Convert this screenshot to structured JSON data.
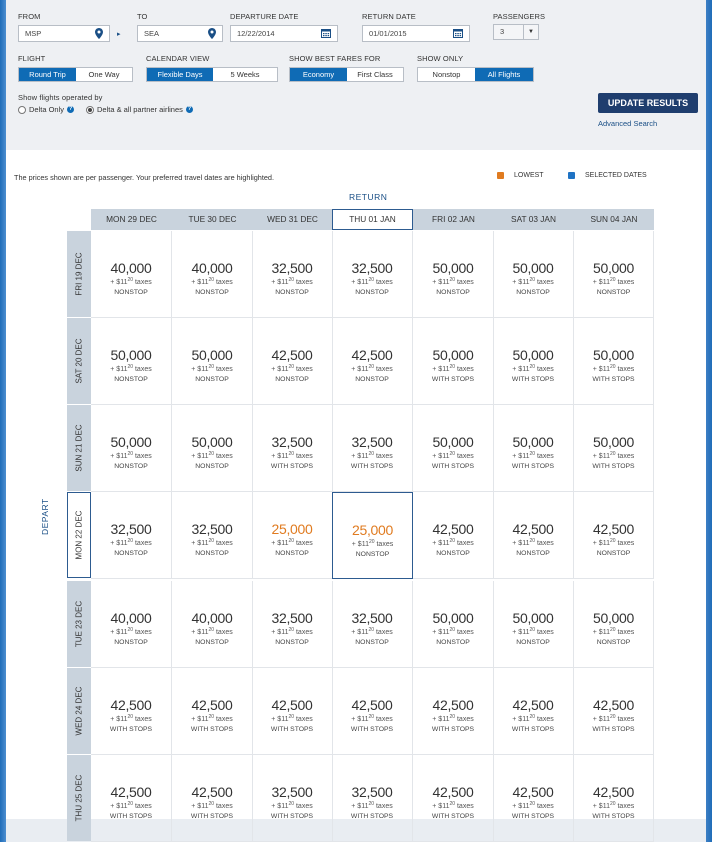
{
  "search": {
    "from_label": "FROM",
    "from_value": "MSP",
    "to_label": "TO",
    "to_value": "SEA",
    "departure_label": "DEPARTURE DATE",
    "departure_value": "12/22/2014",
    "return_label": "RETURN DATE",
    "return_value": "01/01/2015",
    "passengers_label": "PASSENGERS",
    "passengers_value": "3",
    "flight_label": "FLIGHT",
    "flight_options": [
      "Round Trip",
      "One Way"
    ],
    "flight_selected": "Round Trip",
    "calendar_label": "CALENDAR VIEW",
    "calendar_options": [
      "Flexible Days",
      "5 Weeks"
    ],
    "calendar_selected": "Flexible Days",
    "fares_label": "SHOW BEST FARES FOR",
    "fares_options": [
      "Economy",
      "First Class"
    ],
    "fares_selected": "Economy",
    "showonly_label": "SHOW ONLY",
    "showonly_options": [
      "Nonstop",
      "All Flights"
    ],
    "showonly_selected": "All Flights",
    "operated_label": "Show flights operated by",
    "operated_options": [
      "Delta Only",
      "Delta & all partner airlines"
    ],
    "operated_selected": "Delta & all partner airlines",
    "update_button": "UPDATE RESULTS",
    "advanced_link": "Advanced Search"
  },
  "calendar": {
    "note": "The prices shown are per passenger. Your preferred travel dates are highlighted.",
    "legend_lowest": "LOWEST",
    "legend_selected": "SELECTED DATES",
    "legend_lowest_color": "#e07b20",
    "legend_selected_color": "#1f73c4",
    "return_label": "RETURN",
    "depart_label": "DEPART",
    "return_dates": [
      "MON 29 DEC",
      "TUE 30 DEC",
      "WED 31 DEC",
      "THU 01 JAN",
      "FRI 02 JAN",
      "SAT 03 JAN",
      "SUN 04 JAN"
    ],
    "selected_return_index": 3,
    "depart_dates": [
      "FRI 19 DEC",
      "SAT 20 DEC",
      "SUN 21 DEC",
      "MON 22 DEC",
      "TUE 23 DEC",
      "WED 24 DEC",
      "THU 25 DEC"
    ],
    "selected_depart_index": 3,
    "tax_prefix": "+ $",
    "tax_amount": "11",
    "tax_cents": "20",
    "tax_suffix": " taxes",
    "rows": [
      [
        [
          "40,000",
          "NONSTOP"
        ],
        [
          "40,000",
          "NONSTOP"
        ],
        [
          "32,500",
          "NONSTOP"
        ],
        [
          "32,500",
          "NONSTOP"
        ],
        [
          "50,000",
          "NONSTOP"
        ],
        [
          "50,000",
          "NONSTOP"
        ],
        [
          "50,000",
          "NONSTOP"
        ]
      ],
      [
        [
          "50,000",
          "NONSTOP"
        ],
        [
          "50,000",
          "NONSTOP"
        ],
        [
          "42,500",
          "NONSTOP"
        ],
        [
          "42,500",
          "NONSTOP"
        ],
        [
          "50,000",
          "WITH STOPS"
        ],
        [
          "50,000",
          "WITH STOPS"
        ],
        [
          "50,000",
          "WITH STOPS"
        ]
      ],
      [
        [
          "50,000",
          "NONSTOP"
        ],
        [
          "50,000",
          "NONSTOP"
        ],
        [
          "32,500",
          "WITH STOPS"
        ],
        [
          "32,500",
          "WITH STOPS"
        ],
        [
          "50,000",
          "WITH STOPS"
        ],
        [
          "50,000",
          "WITH STOPS"
        ],
        [
          "50,000",
          "WITH STOPS"
        ]
      ],
      [
        [
          "32,500",
          "NONSTOP"
        ],
        [
          "32,500",
          "NONSTOP"
        ],
        [
          "25,000",
          "NONSTOP"
        ],
        [
          "25,000",
          "NONSTOP"
        ],
        [
          "42,500",
          "NONSTOP"
        ],
        [
          "42,500",
          "NONSTOP"
        ],
        [
          "42,500",
          "NONSTOP"
        ]
      ],
      [
        [
          "40,000",
          "NONSTOP"
        ],
        [
          "40,000",
          "NONSTOP"
        ],
        [
          "32,500",
          "NONSTOP"
        ],
        [
          "32,500",
          "NONSTOP"
        ],
        [
          "50,000",
          "NONSTOP"
        ],
        [
          "50,000",
          "NONSTOP"
        ],
        [
          "50,000",
          "NONSTOP"
        ]
      ],
      [
        [
          "42,500",
          "WITH STOPS"
        ],
        [
          "42,500",
          "WITH STOPS"
        ],
        [
          "42,500",
          "WITH STOPS"
        ],
        [
          "42,500",
          "WITH STOPS"
        ],
        [
          "42,500",
          "WITH STOPS"
        ],
        [
          "42,500",
          "WITH STOPS"
        ],
        [
          "42,500",
          "WITH STOPS"
        ]
      ],
      [
        [
          "42,500",
          "WITH STOPS"
        ],
        [
          "42,500",
          "WITH STOPS"
        ],
        [
          "32,500",
          "WITH STOPS"
        ],
        [
          "32,500",
          "WITH STOPS"
        ],
        [
          "42,500",
          "WITH STOPS"
        ],
        [
          "42,500",
          "WITH STOPS"
        ],
        [
          "42,500",
          "WITH STOPS"
        ]
      ]
    ],
    "lowest_cells": [
      [
        3,
        2
      ],
      [
        3,
        3
      ]
    ]
  }
}
